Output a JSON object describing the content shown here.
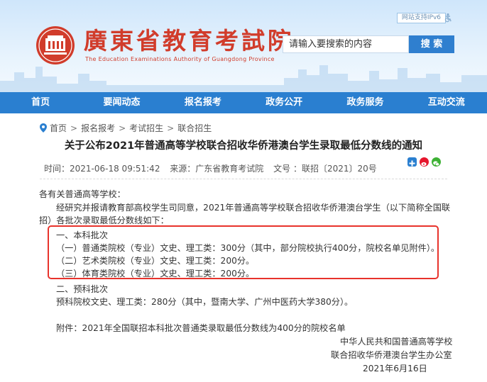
{
  "header": {
    "logo_cn": "廣東省教育考試院",
    "logo_en": "The Education Examinations Authority of Guangdong Province",
    "ipv6_label": "网站支持IPv6",
    "search_placeholder": "请输入要搜索的内容",
    "search_button": "搜 索"
  },
  "nav": {
    "items": [
      "首页",
      "要闻动态",
      "报名报考",
      "政务公开",
      "政务服务",
      "互动交流"
    ]
  },
  "breadcrumb": [
    "首页",
    "报名报考",
    "考试招生",
    "联合招生"
  ],
  "article": {
    "title": "关于公布2021年普通高等学校联合招收华侨港澳台学生录取最低分数线的通知",
    "time": "时间：2021-06-18 09:51:42",
    "source": "来源：广东省教育考试院",
    "doc_no": "文号 ：联招〔2021〕20号",
    "salutation": "各有关普通高等学校：",
    "intro_1": "经研究并报请教育部高校学生司同意，2021年普通高等学校联合招收华侨港澳台学生（以下简称全国联",
    "intro_2": "招）各批次录取最低分数线如下：",
    "sec1": "一、本科批次",
    "sec1_1": "（一）普通类院校（专业）文史、理工类：300分（其中，部分院校执行400分，院校名单见附件）。",
    "sec1_2": "（二）艺术类院校（专业）文史、理工类：200分。",
    "sec1_3": "（三）体育类院校（专业）文史、理工类：200分。",
    "sec2": "二、预科批次",
    "sec2_1": "预科院校文史、理工类：280分（其中，暨南大学、广州中医药大学380分）。",
    "attachment": "附件：2021年全国联招本科批次普通类录取最低分数线为400分的院校名单",
    "sign_1": "中华人民共和国普通高等学校",
    "sign_2": "联合招收华侨港澳台学生办公室",
    "date": "2021年6月16日"
  },
  "colors": {
    "brand_red": "#d13c2b",
    "nav_blue": "#2a7fd0",
    "highlight_red": "#e8332c"
  },
  "share_icons": [
    "plus-share-icon",
    "weibo-icon",
    "wechat-icon"
  ]
}
